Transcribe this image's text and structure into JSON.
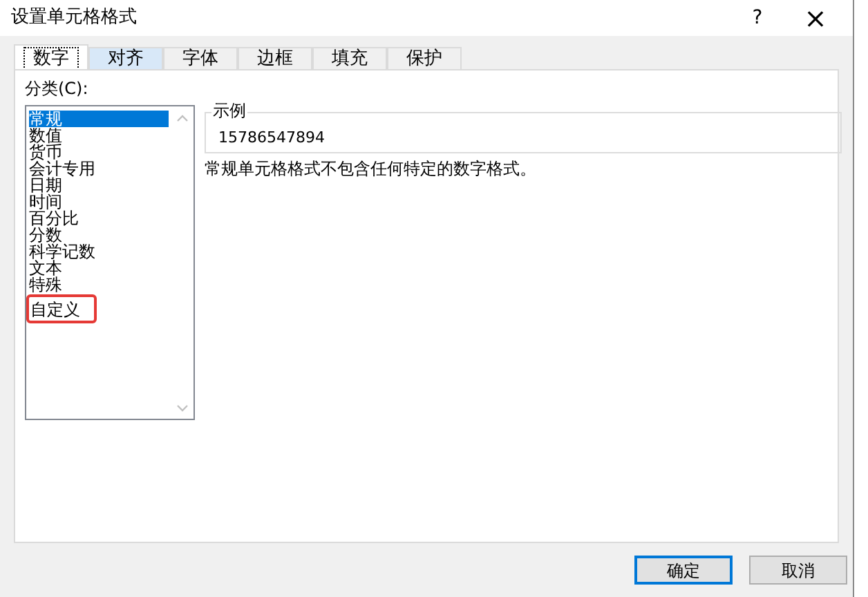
{
  "window": {
    "title": "设置单元格格式",
    "help": "?",
    "close": "×"
  },
  "tabs": [
    {
      "label": "数字",
      "selected": true
    },
    {
      "label": "对齐",
      "selected": false,
      "hover": true
    },
    {
      "label": "字体",
      "selected": false,
      "hover": false
    },
    {
      "label": "边框",
      "selected": false,
      "hover": false
    },
    {
      "label": "填充",
      "selected": false,
      "hover": false
    },
    {
      "label": "保护",
      "selected": false,
      "hover": false
    }
  ],
  "category": {
    "label": "分类(C):",
    "items": [
      {
        "label": "常规",
        "selected": true,
        "highlighted": false
      },
      {
        "label": "数值",
        "selected": false,
        "highlighted": false
      },
      {
        "label": "货币",
        "selected": false,
        "highlighted": false
      },
      {
        "label": "会计专用",
        "selected": false,
        "highlighted": false
      },
      {
        "label": "日期",
        "selected": false,
        "highlighted": false
      },
      {
        "label": "时间",
        "selected": false,
        "highlighted": false
      },
      {
        "label": "百分比",
        "selected": false,
        "highlighted": false
      },
      {
        "label": "分数",
        "selected": false,
        "highlighted": false
      },
      {
        "label": "科学记数",
        "selected": false,
        "highlighted": false
      },
      {
        "label": "文本",
        "selected": false,
        "highlighted": false
      },
      {
        "label": "特殊",
        "selected": false,
        "highlighted": false
      },
      {
        "label": "自定义",
        "selected": false,
        "highlighted": true
      }
    ]
  },
  "sample": {
    "label": "示例",
    "value": "15786547894"
  },
  "description": "常规单元格格式不包含任何特定的数字格式。",
  "buttons": [
    {
      "label": "确定",
      "default": true
    },
    {
      "label": "取消",
      "default": false
    }
  ]
}
